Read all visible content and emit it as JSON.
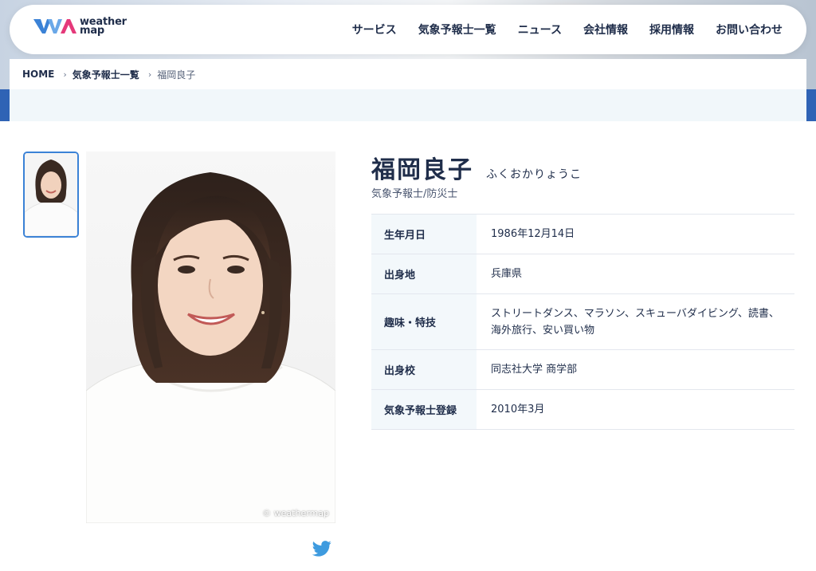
{
  "brand": {
    "logo_line1": "weather",
    "logo_line2": "map",
    "colors": {
      "navy": "#1f2d4a",
      "blue": "#3b82d6",
      "pink": "#e5397a",
      "table_head": "#f3f8fb"
    }
  },
  "nav": {
    "items": [
      {
        "label": "サービス"
      },
      {
        "label": "気象予報士一覧"
      },
      {
        "label": "ニュース"
      },
      {
        "label": "会社情報"
      },
      {
        "label": "採用情報"
      },
      {
        "label": "お問い合わせ"
      }
    ]
  },
  "breadcrumb": {
    "home": "HOME",
    "list": "気象予報士一覧",
    "current": "福岡良子",
    "separator": "›"
  },
  "profile": {
    "name": "福岡良子",
    "kana": "ふくおかりょうこ",
    "role": "気象予報士/防災士",
    "photo_credit": "© weathermap",
    "rows": [
      {
        "label": "生年月日",
        "value": "1986年12月14日"
      },
      {
        "label": "出身地",
        "value": "兵庫県"
      },
      {
        "label": "趣味・特技",
        "value": "ストリートダンス、マラソン、スキューバダイビング、読書、海外旅行、安い買い物"
      },
      {
        "label": "出身校",
        "value": "同志社大学 商学部"
      },
      {
        "label": "気象予報士登録",
        "value": "2010年3月"
      }
    ]
  },
  "share": {
    "icon": "twitter-icon"
  }
}
